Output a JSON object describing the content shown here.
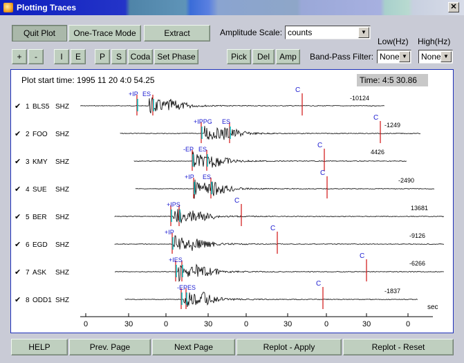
{
  "window": {
    "title": "Plotting Traces",
    "close_glyph": "✕"
  },
  "toolbar": {
    "row1": [
      {
        "label": "Quit Plot",
        "pressed": true
      },
      {
        "label": "One-Trace Mode",
        "pressed": false
      },
      {
        "label": "Extract",
        "pressed": false
      }
    ],
    "row2": [
      "+",
      "-",
      "I",
      "E",
      "P",
      "S",
      "Coda",
      "Set Phase"
    ],
    "pick_buttons": [
      "Pick",
      "Del",
      "Amp"
    ],
    "amplitude_scale": {
      "label": "Amplitude Scale:",
      "value": "counts"
    },
    "bandpass": {
      "label": "Band-Pass Filter:",
      "low_label": "Low(Hz)",
      "high_label": "High(Hz)",
      "low_value": "None",
      "high_value": "None"
    }
  },
  "plot": {
    "start_time": "Plot start time: 1995 11 20  4:0 54.25",
    "current_time": "Time: 4:5  30.86",
    "unit": "sec",
    "x_ticks": [
      "0",
      "30",
      "0",
      "30",
      "0",
      "30",
      "0",
      "30",
      "0"
    ],
    "traces": [
      {
        "num": "1",
        "name": "BLS5",
        "comp": "SHZ",
        "amp": "-10124",
        "picks": [
          "+IP",
          "ES"
        ],
        "coda": "C"
      },
      {
        "num": "2",
        "name": "FOO",
        "comp": "SHZ",
        "amp": "-1249",
        "picks": [
          "+IPPG",
          "ES"
        ],
        "coda": "C"
      },
      {
        "num": "3",
        "name": "KMY",
        "comp": "SHZ",
        "amp": "4426",
        "picks": [
          "-EP",
          "ES"
        ],
        "coda": "C"
      },
      {
        "num": "4",
        "name": "SUE",
        "comp": "SHZ",
        "amp": "-2490",
        "picks": [
          "+IP",
          "ES"
        ],
        "coda": "C"
      },
      {
        "num": "5",
        "name": "BER",
        "comp": "SHZ",
        "amp": "13681",
        "picks": [
          "+IPS"
        ],
        "coda": "C"
      },
      {
        "num": "6",
        "name": "EGD",
        "comp": "SHZ",
        "amp": "-9126",
        "picks": [
          "+IP"
        ],
        "coda": "C"
      },
      {
        "num": "7",
        "name": "ASK",
        "comp": "SHZ",
        "amp": "-6266",
        "picks": [
          "+IES"
        ],
        "coda": "C"
      },
      {
        "num": "8",
        "name": "ODD1",
        "comp": "SHZ",
        "amp": "-1837",
        "picks": [
          "-EPES"
        ],
        "coda": "C"
      }
    ]
  },
  "bottom": [
    "HELP",
    "Prev. Page",
    "Next Page",
    "Replot - Apply",
    "Replot  -  Reset"
  ],
  "colors": {
    "trace": "#000000",
    "pick": "#1a1ad0",
    "coda": "#d01010",
    "p_marker": "#00c8c8",
    "panel_border": "#1c2fb8"
  }
}
